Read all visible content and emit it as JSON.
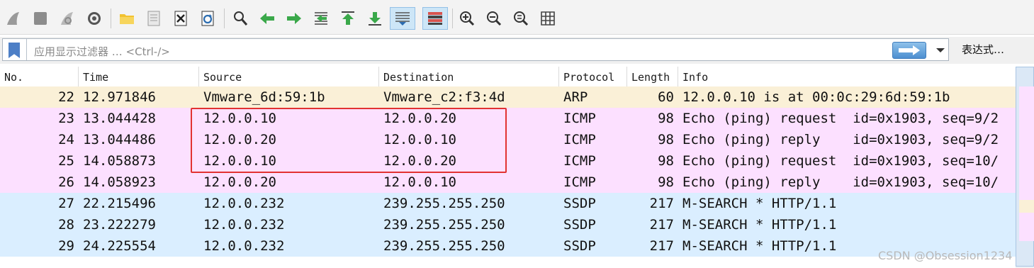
{
  "toolbar": {
    "buttons": [
      {
        "icon": "shark-fin-start-capture-icon"
      },
      {
        "icon": "stop-capture-icon"
      },
      {
        "icon": "restart-capture-icon"
      },
      {
        "icon": "capture-options-gear-icon"
      },
      {
        "icon": "open-folder-icon"
      },
      {
        "icon": "save-file-icon"
      },
      {
        "icon": "close-file-icon"
      },
      {
        "icon": "reload-icon"
      },
      {
        "icon": "find-packet-icon"
      },
      {
        "icon": "go-back-arrow-icon"
      },
      {
        "icon": "go-forward-arrow-icon"
      },
      {
        "icon": "go-to-packet-icon"
      },
      {
        "icon": "go-first-packet-icon"
      },
      {
        "icon": "go-last-packet-icon"
      },
      {
        "icon": "auto-scroll-icon"
      },
      {
        "icon": "colorize-icon"
      },
      {
        "icon": "zoom-in-icon"
      },
      {
        "icon": "zoom-out-icon"
      },
      {
        "icon": "normal-size-icon"
      },
      {
        "icon": "resize-columns-icon"
      }
    ]
  },
  "filter": {
    "placeholder": "应用显示过滤器 … <Ctrl-/>",
    "expression_label": "表达式…"
  },
  "columns": [
    "No.",
    "Time",
    "Source",
    "Destination",
    "Protocol",
    "Length",
    "Info"
  ],
  "rows": [
    {
      "no": "22",
      "time": "12.971846",
      "src": "Vmware_6d:59:1b",
      "dst": "Vmware_c2:f3:4d",
      "proto": "ARP",
      "len": "60",
      "info": "12.0.0.10 is at 00:0c:29:6d:59:1b",
      "bg": "#faf0d7"
    },
    {
      "no": "23",
      "time": "13.044428",
      "src": "12.0.0.10",
      "dst": "12.0.0.20",
      "proto": "ICMP",
      "len": "98",
      "info": "Echo (ping) request  id=0x1903, seq=9/2",
      "bg": "#fce0ff"
    },
    {
      "no": "24",
      "time": "13.044486",
      "src": "12.0.0.20",
      "dst": "12.0.0.10",
      "proto": "ICMP",
      "len": "98",
      "info": "Echo (ping) reply    id=0x1903, seq=9/2",
      "bg": "#fce0ff"
    },
    {
      "no": "25",
      "time": "14.058873",
      "src": "12.0.0.10",
      "dst": "12.0.0.20",
      "proto": "ICMP",
      "len": "98",
      "info": "Echo (ping) request  id=0x1903, seq=10/",
      "bg": "#fce0ff"
    },
    {
      "no": "26",
      "time": "14.058923",
      "src": "12.0.0.20",
      "dst": "12.0.0.10",
      "proto": "ICMP",
      "len": "98",
      "info": "Echo (ping) reply    id=0x1903, seq=10/",
      "bg": "#fce0ff"
    },
    {
      "no": "27",
      "time": "22.215496",
      "src": "12.0.0.232",
      "dst": "239.255.255.250",
      "proto": "SSDP",
      "len": "217",
      "info": "M-SEARCH * HTTP/1.1",
      "bg": "#daeeff"
    },
    {
      "no": "28",
      "time": "23.222279",
      "src": "12.0.0.232",
      "dst": "239.255.255.250",
      "proto": "SSDP",
      "len": "217",
      "info": "M-SEARCH * HTTP/1.1",
      "bg": "#daeeff"
    },
    {
      "no": "29",
      "time": "24.225554",
      "src": "12.0.0.232",
      "dst": "239.255.255.250",
      "proto": "SSDP",
      "len": "217",
      "info": "M-SEARCH * HTTP/1.1",
      "bg": "#daeeff"
    }
  ],
  "colors": {
    "arp_row": "#faf0d7",
    "icmp_row": "#fce0ff",
    "ssdp_row": "#daeeff",
    "highlight_box": "#e23232",
    "accent": "#4d8fd0"
  },
  "watermark": "CSDN @Obsession1234"
}
